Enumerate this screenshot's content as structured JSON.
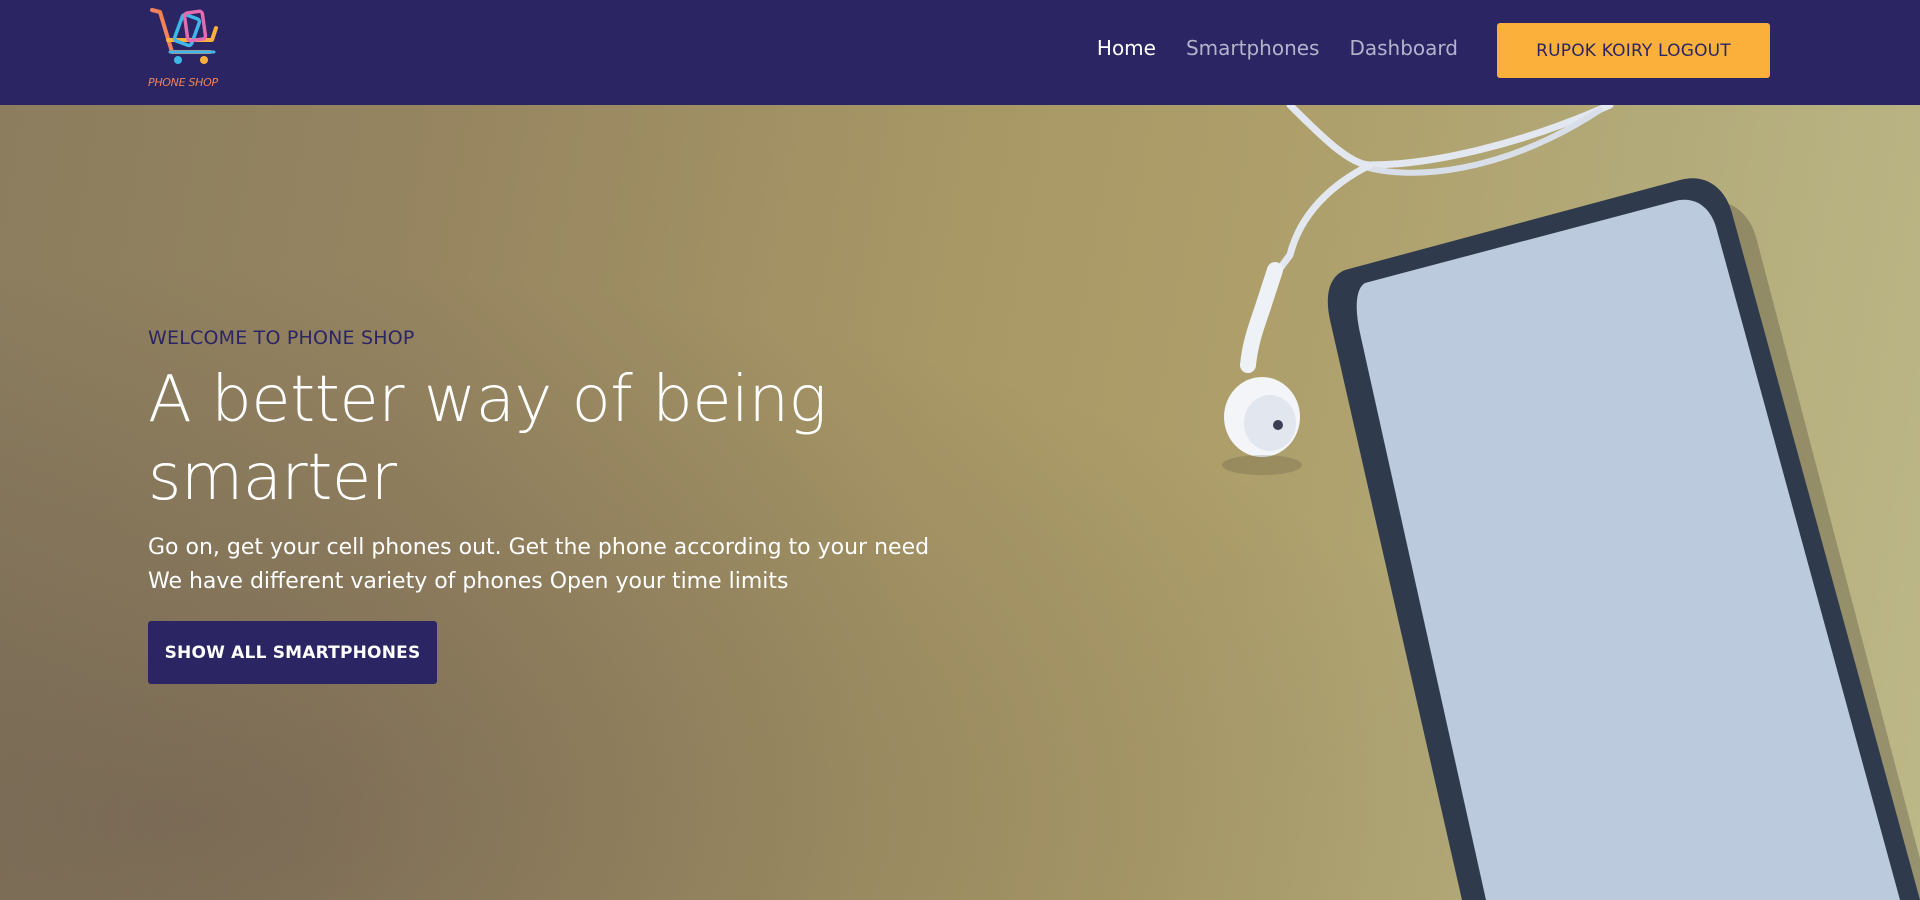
{
  "header": {
    "logo_text": "PHONE SHOP",
    "nav": [
      {
        "label": "Home",
        "active": true
      },
      {
        "label": "Smartphones",
        "active": false
      },
      {
        "label": "Dashboard",
        "active": false
      }
    ],
    "logout_label": "RUPOK KOIRY LOGOUT"
  },
  "hero": {
    "eyebrow": "WELCOME TO PHONE SHOP",
    "headline": "A better way of being smarter",
    "sub_line_1": "Go on, get your cell phones out. Get the phone according to your need",
    "sub_line_2": "We have different variety of phones Open your time limits",
    "cta_label": "SHOW ALL SMARTPHONES"
  },
  "colors": {
    "navbar": "#2b2563",
    "accent": "#fbb03b",
    "primary_button": "#2b2563"
  },
  "icons": {
    "logo": "shopping-cart-phone-logo"
  }
}
